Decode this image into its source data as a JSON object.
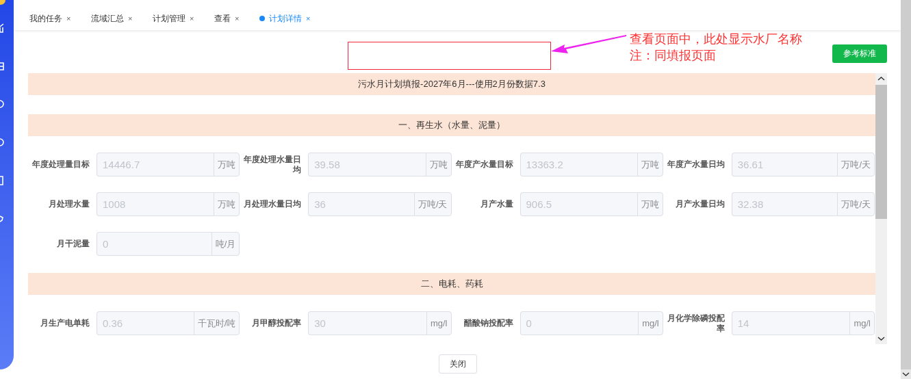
{
  "tabs": [
    {
      "label": "我的任务",
      "close": "×",
      "selected": false
    },
    {
      "label": "流域汇总",
      "close": "×",
      "selected": false
    },
    {
      "label": "计划管理",
      "close": "×",
      "selected": false
    },
    {
      "label": "查看",
      "close": "×",
      "selected": false
    },
    {
      "label": "计划详情",
      "close": "×",
      "selected": true
    }
  ],
  "annotation": {
    "lines": [
      "查看页面中，此处显示水厂名称",
      "注：同填报页面"
    ]
  },
  "reference_button": "参考标准",
  "form_title": "污水月计划填报-2027年6月---使用2月份数据7.3",
  "sections": [
    {
      "title": "一、再生水（水量、泥量）",
      "fields": [
        {
          "label": "年度处理量目标",
          "value": "14446.7",
          "unit": "万吨",
          "disabled": true
        },
        {
          "label": "年度处理水量日均",
          "value": "39.58",
          "unit": "万吨",
          "disabled": true
        },
        {
          "label": "年度产水量目标",
          "value": "13363.2",
          "unit": "万吨",
          "disabled": true
        },
        {
          "label": "年度产水量日均",
          "value": "36.61",
          "unit": "万吨/天",
          "disabled": true
        },
        {
          "label": "月处理水量",
          "value": "1008",
          "unit": "万吨",
          "disabled": true
        },
        {
          "label": "月处理水量日均",
          "value": "36",
          "unit": "万吨/天",
          "disabled": true
        },
        {
          "label": "月产水量",
          "value": "906.5",
          "unit": "万吨",
          "disabled": true
        },
        {
          "label": "月产水量日均",
          "value": "32.38",
          "unit": "万吨/天",
          "disabled": true
        },
        {
          "label": "月干泥量",
          "value": "0",
          "unit": "吨/月",
          "disabled": true
        }
      ]
    },
    {
      "title": "二、电耗、药耗",
      "fields": [
        {
          "label": "月生产电单耗",
          "value": "0.36",
          "unit": "千瓦时/吨",
          "disabled": true
        },
        {
          "label": "月甲醇投配率",
          "value": "30",
          "unit": "mg/l",
          "disabled": true
        },
        {
          "label": "醋酸钠投配率",
          "value": "0",
          "unit": "mg/l",
          "disabled": true
        },
        {
          "label": "月化学除磷投配率",
          "value": "14",
          "unit": "mg/l",
          "disabled": true
        }
      ]
    }
  ],
  "close_button": "关闭"
}
